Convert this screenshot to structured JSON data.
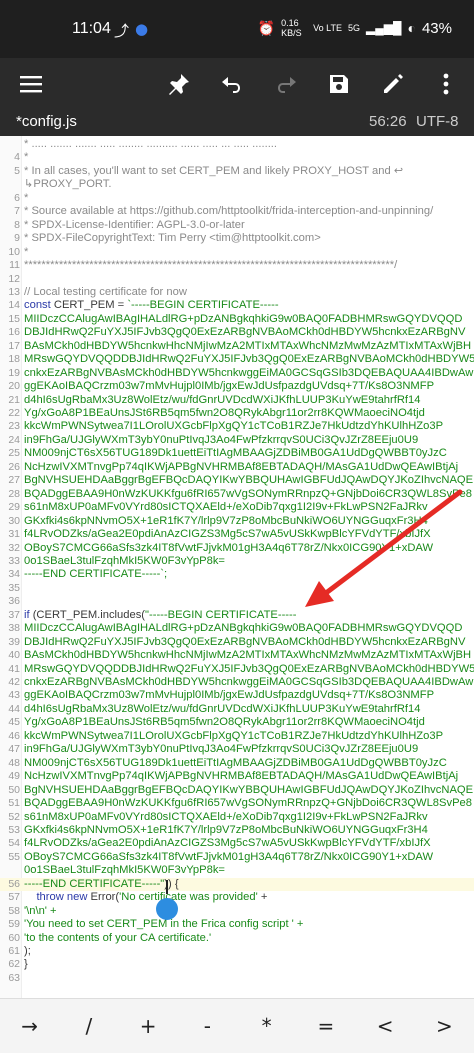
{
  "status_bar": {
    "time": "11:04",
    "net_speed": "0.16 KB/S",
    "network": "Vo LTE",
    "signal": "5G",
    "battery": "43%"
  },
  "toolbar": {
    "icons": [
      "menu-icon",
      "pin-icon",
      "undo-icon",
      "redo-icon",
      "save-icon",
      "edit-icon",
      "more-vert-icon"
    ]
  },
  "tab": {
    "filename": "*config.js",
    "position": "56:26",
    "encoding": "UTF-8"
  },
  "editor": {
    "lines": [
      {
        "n": "",
        "t": "    * ..... ....... ....... ..... ........ .......... ...... ..... ... ..... ........",
        "k": "cmt"
      },
      {
        "n": "4",
        "t": "*",
        "k": "cmt"
      },
      {
        "n": "5",
        "t": "* In all cases, you'll want to set CERT_PEM and likely PROXY_HOST and ↩",
        "k": "cmt"
      },
      {
        "n": "",
        "t": "↳PROXY_PORT.",
        "k": "cmt"
      },
      {
        "n": "6",
        "t": "*",
        "k": "cmt"
      },
      {
        "n": "7",
        "t": "* Source available at https://github.com/httptoolkit/frida-interception-and-unpinning/",
        "k": "cmt"
      },
      {
        "n": "8",
        "t": "* SPDX-License-Identifier: AGPL-3.0-or-later",
        "k": "cmt"
      },
      {
        "n": "9",
        "t": "* SPDX-FileCopyrightText: Tim Perry <tim@httptoolkit.com>",
        "k": "cmt"
      },
      {
        "n": "10",
        "t": "*",
        "k": "cmt"
      },
      {
        "n": "11",
        "t": "*************************************************************************************/",
        "k": "cmt"
      },
      {
        "n": "12",
        "t": "",
        "k": ""
      },
      {
        "n": "13",
        "t": "// Local testing certificate for now",
        "k": "cmt"
      },
      {
        "n": "14",
        "t": "const CERT_PEM = `-----BEGIN CERTIFICATE-----",
        "k": "decl"
      },
      {
        "n": "15",
        "t": "MIIDczCCAlugAwIBAgIHALdlRG+pDzANBgkqhkiG9w0BAQ0FADBHMRswGQYDVQQD",
        "k": "str"
      },
      {
        "n": "16",
        "t": "DBJIdHRwQ2FuYXJ5IFJvb3QgQ0ExEzARBgNVBAoMCkh0dHBDYW5hcnkxEzARBgNV",
        "k": "str"
      },
      {
        "n": "17",
        "t": "BAsMCkh0dHBDYW5hcnkwHhcNMjIwMzA2MTIxMTAxWhcNMzMwMzAzMTIxMTAxWjBH",
        "k": "str"
      },
      {
        "n": "18",
        "t": "MRswGQYDVQQDDBJIdHRwQ2FuYXJ5IFJvb3QgQ0ExEzARBgNVBAoMCkh0dHBDYW5h",
        "k": "str"
      },
      {
        "n": "19",
        "t": "cnkxEzARBgNVBAsMCkh0dHBDYW5hcnkwggEiMA0GCSqGSIb3DQEBAQUAA4IBDwAw",
        "k": "str"
      },
      {
        "n": "20",
        "t": "ggEKAoIBAQCrzm03w7mMvHujpl0IMb/jgxEwJdUsfpazdgUVdsq+7T/Ks8O3NMFP",
        "k": "str"
      },
      {
        "n": "21",
        "t": "d4hI6sUgRbaMx3Uz8WolEtz/wu/fdGnrUVDcdWXiJKfhLUUP3KuYwE9tahrfRf14",
        "k": "str"
      },
      {
        "n": "22",
        "t": "Yg/xGoA8P1BEaUnsJSt6RB5qm5fwn2O8QRykAbgr11or2rr8KQWMaoeciNO4tjd",
        "k": "str"
      },
      {
        "n": "23",
        "t": "kkcWmPWNSytwea7I1LOrolUXGcbFlpXgQY1cTCoB1RZJe7HkUdtzdYhKUlhHZo3P",
        "k": "str"
      },
      {
        "n": "24",
        "t": "in9FhGa/UJGlyWXmT3ybY0nuPtIvqJ3Ao4FwPfzkrrqvS0UCi3QvJZrZ8EEju0U9",
        "k": "str"
      },
      {
        "n": "25",
        "t": "NM009njCT6sX56TUG189Dk1uettEiTtIAgMBAAGjZDBiMB0GA1UdDgQWBBT0yJzC",
        "k": "str"
      },
      {
        "n": "26",
        "t": "NcHzwIVXMTnvgPp74qIKWjAPBgNVHRMBAf8EBTADAQH/MAsGA1UdDwQEAwIBtjAj",
        "k": "str"
      },
      {
        "n": "27",
        "t": "BgNVHSUEHDAaBggrBgEFBQcDAQYIKwYBBQUHAwIGBFUdJQAwDQYJKoZIhvcNAQEN",
        "k": "str"
      },
      {
        "n": "28",
        "t": "BQADggEBAA9H0nWzKUKKfgu6fRI657wVgSONymRRnpzQ+GNjbDoi6CR3QWL8SvPe8",
        "k": "str"
      },
      {
        "n": "29",
        "t": "s61nM8xUP0aMFv0VYrd80sICTQXAEld+/eXoDib7qxg1I2I9v+FkLwPSN2FaJRkv",
        "k": "str"
      },
      {
        "n": "30",
        "t": "GKxfki4s6kpNNvmO5X+1eR1fK7Y/lrlp9V7zP8oMbcBuNkiWO6UYNGGuqxFr3H4",
        "k": "str"
      },
      {
        "n": "31",
        "t": "f4LRvODZks/aGea2E0pdiAnAzCIGZS3Mg5cS7wA5vUSkKwpBlcYFVdYTF/xbIJfX",
        "k": "str"
      },
      {
        "n": "32",
        "t": "OBoyS7CMCG66aSfs3zk4IT8fVwtFJjvkM01gH3A4q6T78rZ/Nkx0ICG90Y1+xDAW",
        "k": "str"
      },
      {
        "n": "33",
        "t": "0o1SBaeL3tulFzqhMkI5KW0F3vYpP8k=",
        "k": "str"
      },
      {
        "n": "34",
        "t": "-----END CERTIFICATE-----`;",
        "k": "str"
      },
      {
        "n": "35",
        "t": "",
        "k": ""
      },
      {
        "n": "36",
        "t": "",
        "k": ""
      },
      {
        "n": "37",
        "t": "if (CERT_PEM.includes(\"-----BEGIN CERTIFICATE-----",
        "k": "ifline"
      },
      {
        "n": "38",
        "t": "MIIDczCCAlugAwIBAgIHALdlRG+pDzANBgkqhkiG9w0BAQ0FADBHMRswGQYDVQQD",
        "k": "str"
      },
      {
        "n": "39",
        "t": "DBJIdHRwQ2FuYXJ5IFJvb3QgQ0ExEzARBgNVBAoMCkh0dHBDYW5hcnkxEzARBgNV",
        "k": "str"
      },
      {
        "n": "40",
        "t": "BAsMCkh0dHBDYW5hcnkwHhcNMjIwMzA2MTIxMTAxWhcNMzMwMzAzMTIxMTAxWjBH",
        "k": "str"
      },
      {
        "n": "41",
        "t": "MRswGQYDVQQDDBJIdHRwQ2FuYXJ5IFJvb3QgQ0ExEzARBgNVBAoMCkh0dHBDYW5h",
        "k": "str"
      },
      {
        "n": "42",
        "t": "cnkxEzARBgNVBAsMCkh0dHBDYW5hcnkwggEiMA0GCSqGSIb3DQEBAQUAA4IBDwAw",
        "k": "str"
      },
      {
        "n": "43",
        "t": "ggEKAoIBAQCrzm03w7mMvHujpl0IMb/jgxEwJdUsfpazdgUVdsq+7T/Ks8O3NMFP",
        "k": "str"
      },
      {
        "n": "44",
        "t": "d4hI6sUgRbaMx3Uz8WolEtz/wu/fdGnrUVDcdWXiJKfhLUUP3KuYwE9tahrfRf14",
        "k": "str"
      },
      {
        "n": "45",
        "t": "Yg/xGoA8P1BEaUnsJSt6RB5qm5fwn2O8QRykAbgr11or2rr8KQWMaoeciNO4tjd",
        "k": "str"
      },
      {
        "n": "46",
        "t": "kkcWmPWNSytwea7I1LOrolUXGcbFlpXgQY1cTCoB1RZJe7HkUdtzdYhKUlhHZo3P",
        "k": "str"
      },
      {
        "n": "47",
        "t": "in9FhGa/UJGlyWXmT3ybY0nuPtIvqJ3Ao4FwPfzkrrqvS0UCi3QvJZrZ8EEju0U9",
        "k": "str"
      },
      {
        "n": "48",
        "t": "NM009njCT6sX56TUG189Dk1uettEiTtIAgMBAAGjZDBiMB0GA1UdDgQWBBT0yJzC",
        "k": "str"
      },
      {
        "n": "49",
        "t": "NcHzwIVXMTnvgPp74qIKWjAPBgNVHRMBAf8EBTADAQH/MAsGA1UdDwQEAwIBtjAj",
        "k": "str"
      },
      {
        "n": "50",
        "t": "BgNVHSUEHDAaBggrBgEFBQcDAQYIKwYBBQUHAwIGBFUdJQAwDQYJKoZIhvcNAQEN",
        "k": "str"
      },
      {
        "n": "51",
        "t": "BQADggEBAA9H0nWzKUKKfgu6fRI657wVgSONymRRnpzQ+GNjbDoi6CR3QWL8SvPe8",
        "k": "str"
      },
      {
        "n": "52",
        "t": "s61nM8xUP0aMFv0VYrd80sICTQXAEld+/eXoDib7qxg1I2I9v+FkLwPSN2FaJRkv",
        "k": "str"
      },
      {
        "n": "53",
        "t": "GKxfki4s6kpNNvmO5X+1eR1fK7Y/lrlp9V7zP8oMbcBuNkiWO6UYNGGuqxFr3H4",
        "k": "str"
      },
      {
        "n": "54",
        "t": "f4LRvODZks/aGea2E0pdiAnAzCIGZS3Mg5cS7wA5vUSkKwpBlcYFVdYTF/xbIJfX",
        "k": "str"
      },
      {
        "n": "55",
        "t": "OBoyS7CMCG66aSfs3zk4IT8fVwtFJjvkM01gH3A4q6T78rZ/Nkx0ICG90Y1+xDAW",
        "k": "str"
      },
      {
        "n": "",
        "t": "0o1SBaeL3tulFzqhMkI5KW0F3vYpP8k=",
        "k": "str"
      },
      {
        "n": "56",
        "t": "-----END CERTIFICATE-----\")) {",
        "k": "endline"
      },
      {
        "n": "57",
        "t": "    throw new Error('No certificate was provided' +",
        "k": "throw"
      },
      {
        "n": "58",
        "t": "        '\\n\\n' +",
        "k": "str"
      },
      {
        "n": "59",
        "t": "        'You need to set CERT_PEM in the Frica config script ' +",
        "k": "str"
      },
      {
        "n": "60",
        "t": "        'to the contents of your CA certificate.'",
        "k": "str"
      },
      {
        "n": "61",
        "t": "    );",
        "k": ""
      },
      {
        "n": "62",
        "t": "}",
        "k": ""
      },
      {
        "n": "63",
        "t": "",
        "k": ""
      }
    ]
  },
  "keys": [
    "→",
    "/",
    "+",
    "-",
    "*",
    "=",
    "<",
    ">"
  ]
}
